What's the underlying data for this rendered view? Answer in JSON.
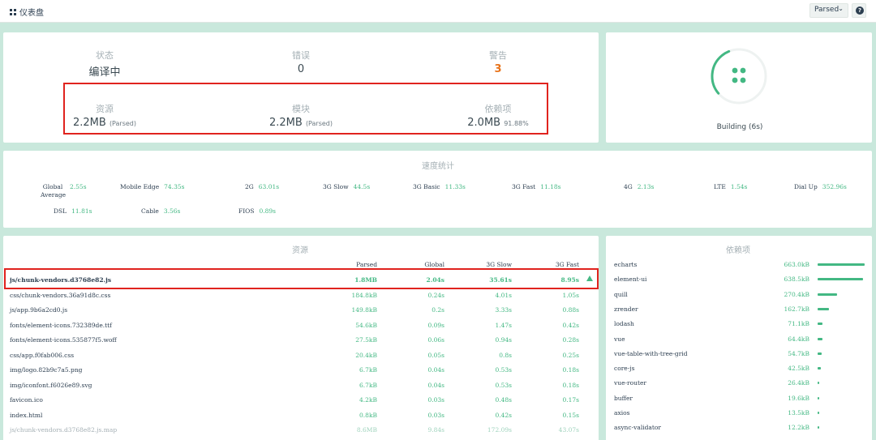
{
  "header": {
    "title": "仪表盘",
    "mode": "Parsed",
    "help": "?"
  },
  "stats": {
    "status": {
      "label": "状态",
      "value": "编译中"
    },
    "errors": {
      "label": "错误",
      "value": "0"
    },
    "warnings": {
      "label": "警告",
      "value": "3"
    },
    "assets": {
      "label": "资源",
      "value": "2.2MB",
      "note": "(Parsed)"
    },
    "modules": {
      "label": "模块",
      "value": "2.2MB",
      "note": "(Parsed)"
    },
    "deps": {
      "label": "依赖项",
      "value": "2.0MB",
      "note": "91.88%"
    }
  },
  "build": {
    "status": "Building (6s)",
    "progress": 0.3
  },
  "speed": {
    "title": "速度统计",
    "items": [
      {
        "label": "Global Average",
        "value": "2.55s"
      },
      {
        "label": "Mobile Edge",
        "value": "74.35s"
      },
      {
        "label": "2G",
        "value": "63.01s"
      },
      {
        "label": "3G Slow",
        "value": "44.5s"
      },
      {
        "label": "3G Basic",
        "value": "11.33s"
      },
      {
        "label": "3G Fast",
        "value": "11.18s"
      },
      {
        "label": "4G",
        "value": "2.13s"
      },
      {
        "label": "LTE",
        "value": "1.54s"
      },
      {
        "label": "Dial Up",
        "value": "352.96s"
      },
      {
        "label": "DSL",
        "value": "11.81s"
      },
      {
        "label": "Cable",
        "value": "3.56s"
      },
      {
        "label": "FIOS",
        "value": "0.89s"
      }
    ]
  },
  "assets": {
    "title": "资源",
    "columns": [
      "Parsed",
      "Global",
      "3G Slow",
      "3G Fast"
    ],
    "rows": [
      {
        "name": "js/chunk-vendors.d3768e82.js",
        "parsed": "1.8MB",
        "global": "2.04s",
        "slow": "35.61s",
        "fast": "8.95s"
      },
      {
        "name": "css/chunk-vendors.36a91d8c.css",
        "parsed": "184.8kB",
        "global": "0.24s",
        "slow": "4.01s",
        "fast": "1.05s"
      },
      {
        "name": "js/app.9b6a2cd0.js",
        "parsed": "149.8kB",
        "global": "0.2s",
        "slow": "3.33s",
        "fast": "0.88s"
      },
      {
        "name": "fonts/element-icons.732389de.ttf",
        "parsed": "54.6kB",
        "global": "0.09s",
        "slow": "1.47s",
        "fast": "0.42s"
      },
      {
        "name": "fonts/element-icons.535877f5.woff",
        "parsed": "27.5kB",
        "global": "0.06s",
        "slow": "0.94s",
        "fast": "0.28s"
      },
      {
        "name": "css/app.f0fab006.css",
        "parsed": "20.4kB",
        "global": "0.05s",
        "slow": "0.8s",
        "fast": "0.25s"
      },
      {
        "name": "img/logo.82b9c7a5.png",
        "parsed": "6.7kB",
        "global": "0.04s",
        "slow": "0.53s",
        "fast": "0.18s"
      },
      {
        "name": "img/iconfont.f6026e89.svg",
        "parsed": "6.7kB",
        "global": "0.04s",
        "slow": "0.53s",
        "fast": "0.18s"
      },
      {
        "name": "favicon.ico",
        "parsed": "4.2kB",
        "global": "0.03s",
        "slow": "0.48s",
        "fast": "0.17s"
      },
      {
        "name": "index.html",
        "parsed": "0.8kB",
        "global": "0.03s",
        "slow": "0.42s",
        "fast": "0.15s"
      },
      {
        "name": "js/chunk-vendors.d3768e82.js.map",
        "parsed": "8.6MB",
        "global": "9.84s",
        "slow": "172.09s",
        "fast": "43.07s"
      }
    ]
  },
  "dependencies": {
    "title": "依赖项",
    "rows": [
      {
        "name": "echarts",
        "size": "663.0kB",
        "ratio": 1.0
      },
      {
        "name": "element-ui",
        "size": "638.5kB",
        "ratio": 0.963
      },
      {
        "name": "quill",
        "size": "270.4kB",
        "ratio": 0.408
      },
      {
        "name": "zrender",
        "size": "162.7kB",
        "ratio": 0.245
      },
      {
        "name": "lodash",
        "size": "71.1kB",
        "ratio": 0.107
      },
      {
        "name": "vue",
        "size": "64.4kB",
        "ratio": 0.097
      },
      {
        "name": "vue-table-with-tree-grid",
        "size": "54.7kB",
        "ratio": 0.083
      },
      {
        "name": "core-js",
        "size": "42.5kB",
        "ratio": 0.064
      },
      {
        "name": "vue-router",
        "size": "26.4kB",
        "ratio": 0.04
      },
      {
        "name": "buffer",
        "size": "19.6kB",
        "ratio": 0.03
      },
      {
        "name": "axios",
        "size": "13.5kB",
        "ratio": 0.02
      },
      {
        "name": "async-validator",
        "size": "12.2kB",
        "ratio": 0.018
      }
    ]
  },
  "colors": {
    "accent": "#43b883",
    "warning": "#e8731a",
    "highlight": "#e0231e",
    "background": "#c9e8dc"
  }
}
